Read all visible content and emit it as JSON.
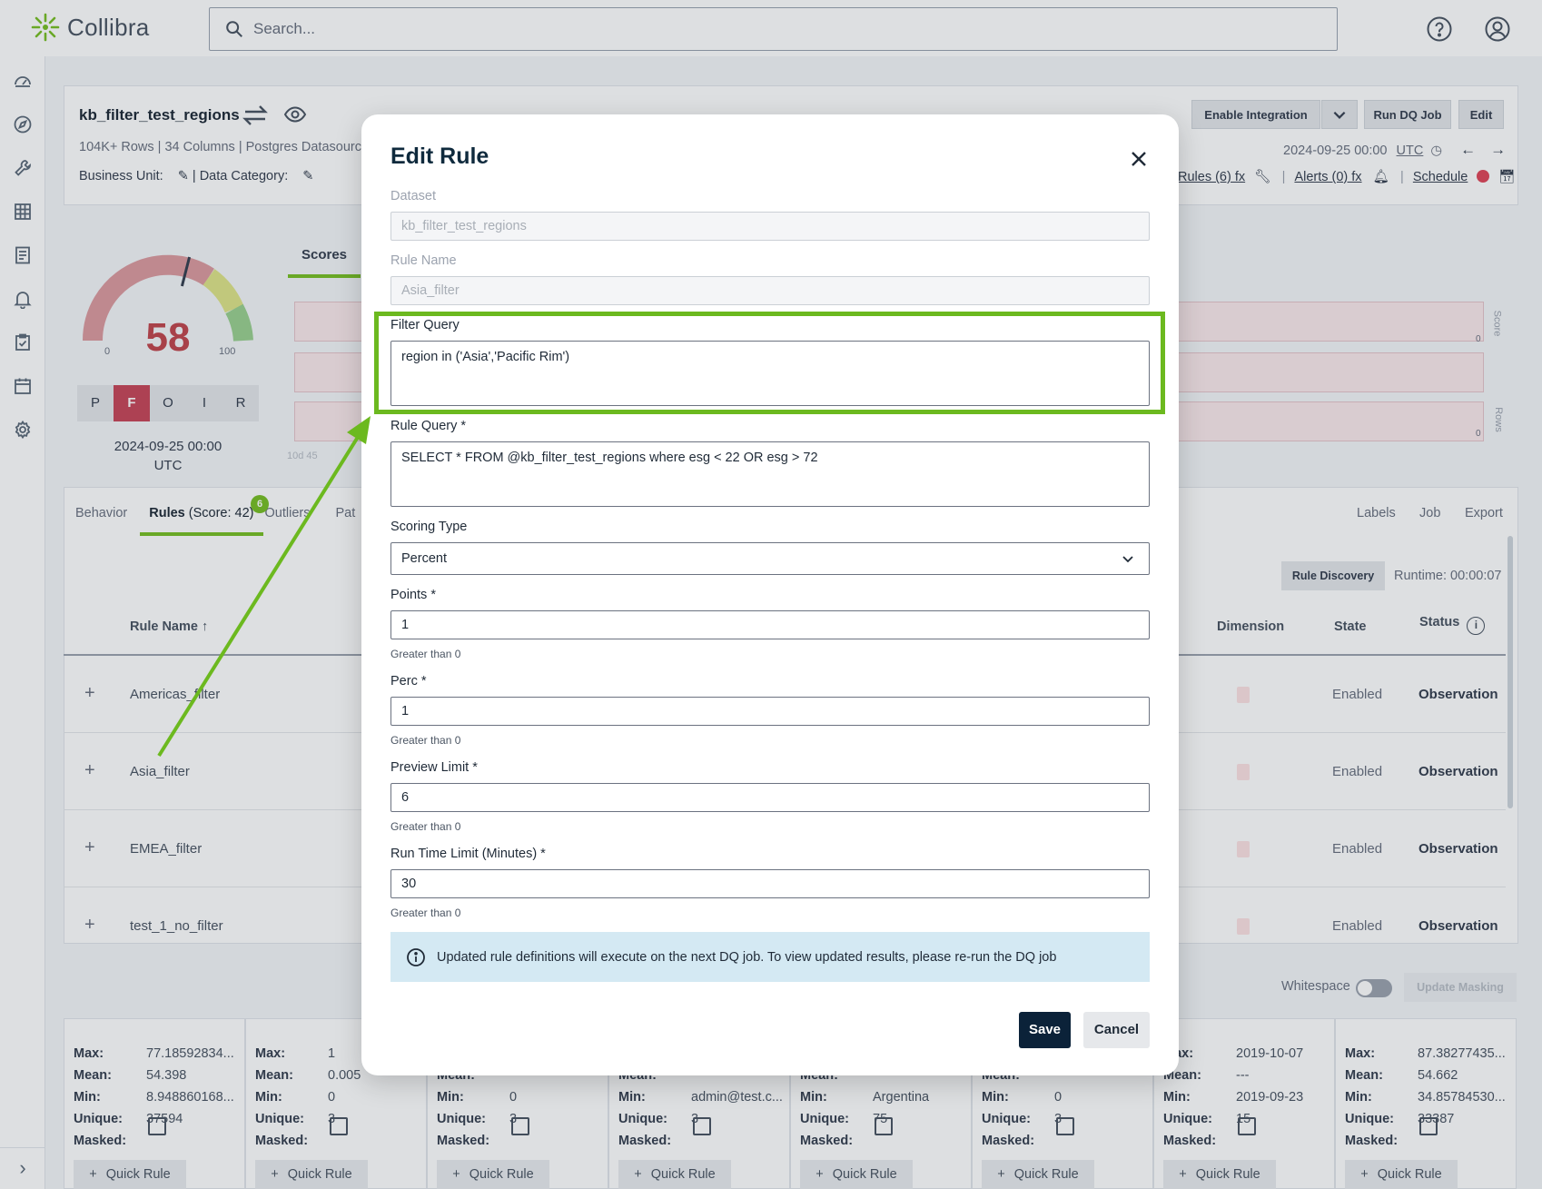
{
  "app": {
    "brand": "Collibra",
    "search_placeholder": "Search..."
  },
  "dataset": {
    "name": "kb_filter_test_regions",
    "meta": "104K+ Rows | 34 Columns | Postgres Datasourc",
    "business_unit_label": "Business Unit:",
    "data_category_label": "| Data Category:",
    "date": "2024-09-25 00:00",
    "tz": "UTC",
    "links": {
      "rules": "Rules (6) fx",
      "alerts": "Alerts (0) fx",
      "schedule": "Schedule"
    },
    "buttons": {
      "enable_integration": "Enable Integration",
      "run_dq_job": "Run DQ Job",
      "edit": "Edit"
    }
  },
  "score": {
    "value": "58",
    "min": "0",
    "max": "100",
    "level": 58,
    "grades": [
      "P",
      "F",
      "O",
      "I",
      "R"
    ],
    "active_grade": "F",
    "date": "2024-09-25 00:00",
    "tz": "UTC"
  },
  "scores_tab": "Scores",
  "chart_side_labels": {
    "score": "Score",
    "rows": "Rows",
    "zero_top": "0",
    "zero_bottom": "0",
    "ticks": "10d  45"
  },
  "tabs": {
    "behavior": "Behavior",
    "rules": "Rules",
    "rules_score": "(Score: 42)",
    "rules_badge": "6",
    "outliers": "Outliers",
    "patterns": "Pat",
    "labels": "Labels",
    "job": "Job",
    "export": "Export"
  },
  "rules_toolbar": {
    "rule_discovery": "Rule Discovery",
    "runtime": "Runtime: 00:00:07"
  },
  "rules_table": {
    "headers": {
      "rule_name": "Rule Name ↑",
      "dimension": "Dimension",
      "state": "State",
      "status": "Status"
    },
    "rows": [
      {
        "name": "Americas_filter",
        "state": "Enabled",
        "status": "Observation"
      },
      {
        "name": "Asia_filter",
        "state": "Enabled",
        "status": "Observation"
      },
      {
        "name": "EMEA_filter",
        "state": "Enabled",
        "status": "Observation"
      },
      {
        "name": "test_1_no_filter",
        "state": "Enabled",
        "status": "Observation"
      }
    ]
  },
  "masking": {
    "whitespace": "Whitespace",
    "update_masking": "Update Masking"
  },
  "column_cards": [
    {
      "rows": [
        [
          "Max:",
          "77.18592834..."
        ],
        [
          "Mean:",
          "54.398"
        ],
        [
          "Min:",
          "8.948860168..."
        ],
        [
          "Unique:",
          "37594"
        ],
        [
          "Masked:",
          ""
        ]
      ],
      "quick_rule": "Quick Rule"
    },
    {
      "rows": [
        [
          "Max:",
          "1"
        ],
        [
          "Mean:",
          "0.005"
        ],
        [
          "Min:",
          "0"
        ],
        [
          "Unique:",
          "3"
        ],
        [
          "Masked:",
          ""
        ]
      ],
      "quick_rule": "Quick Rule"
    },
    {
      "rows": [
        [
          "Max:",
          ""
        ],
        [
          "Mean:",
          ""
        ],
        [
          "Min:",
          "0"
        ],
        [
          "Unique:",
          "3"
        ],
        [
          "Masked:",
          ""
        ]
      ],
      "quick_rule": "Quick Rule"
    },
    {
      "rows": [
        [
          "Max:",
          ""
        ],
        [
          "Mean:",
          ""
        ],
        [
          "Min:",
          "admin@test.c..."
        ],
        [
          "Unique:",
          "3"
        ],
        [
          "Masked:",
          ""
        ]
      ],
      "quick_rule": "Quick Rule"
    },
    {
      "rows": [
        [
          "Max:",
          ""
        ],
        [
          "Mean:",
          ""
        ],
        [
          "Min:",
          "Argentina"
        ],
        [
          "Unique:",
          "75"
        ],
        [
          "Masked:",
          ""
        ]
      ],
      "quick_rule": "Quick Rule"
    },
    {
      "rows": [
        [
          "Max:",
          ""
        ],
        [
          "Mean:",
          ""
        ],
        [
          "Min:",
          "0"
        ],
        [
          "Unique:",
          "3"
        ],
        [
          "Masked:",
          ""
        ]
      ],
      "quick_rule": "Quick Rule"
    },
    {
      "rows": [
        [
          "Max:",
          "2019-10-07"
        ],
        [
          "Mean:",
          "---"
        ],
        [
          "Min:",
          "2019-09-23"
        ],
        [
          "Unique:",
          "15"
        ],
        [
          "Masked:",
          ""
        ]
      ],
      "quick_rule": "Quick Rule"
    },
    {
      "rows": [
        [
          "Max:",
          "87.38277435..."
        ],
        [
          "Mean:",
          "54.662"
        ],
        [
          "Min:",
          "34.85784530..."
        ],
        [
          "Unique:",
          "33387"
        ],
        [
          "Masked:",
          ""
        ]
      ],
      "quick_rule": "Quick Rule"
    }
  ],
  "modal": {
    "title": "Edit Rule",
    "dataset_label": "Dataset",
    "dataset_value": "kb_filter_test_regions",
    "rule_name_label": "Rule Name",
    "rule_name_value": "Asia_filter",
    "filter_query_label": "Filter Query",
    "filter_query_value": "region in ('Asia','Pacific Rim')",
    "rule_query_label": "Rule Query *",
    "rule_query_value": "SELECT * FROM @kb_filter_test_regions where esg < 22 OR esg > 72",
    "scoring_type_label": "Scoring Type",
    "scoring_type_value": "Percent",
    "points_label": "Points *",
    "points_value": "1",
    "points_help": "Greater than 0",
    "perc_label": "Perc *",
    "perc_value": "1",
    "perc_help": "Greater than 0",
    "preview_limit_label": "Preview Limit *",
    "preview_limit_value": "6",
    "preview_limit_help": "Greater than 0",
    "run_time_label": "Run Time Limit (Minutes) *",
    "run_time_value": "30",
    "run_time_help": "Greater than 0",
    "info": "Updated rule definitions will execute on the next DQ job. To view updated results, please re-run the DQ job",
    "save": "Save",
    "cancel": "Cancel"
  },
  "colors": {
    "accent": "#78bf26",
    "highlight": "#6cb91f",
    "fail": "#c8485a",
    "primary": "#0b2239",
    "info_bg": "#d4e9f3"
  }
}
